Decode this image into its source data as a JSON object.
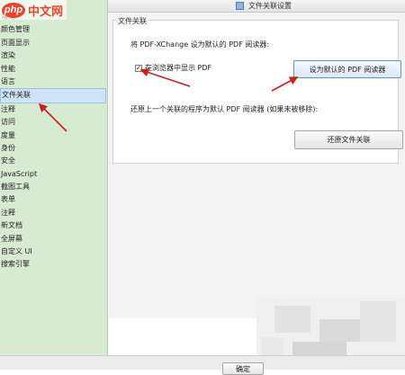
{
  "watermark": {
    "badge": "php",
    "text": "中文网"
  },
  "window": {
    "title": "文件关联设置"
  },
  "sidebar": {
    "items": [
      {
        "label": "常规"
      },
      {
        "label": "颜色管理"
      },
      {
        "label": "页面显示"
      },
      {
        "label": "渲染"
      },
      {
        "label": "性能"
      },
      {
        "label": "语言"
      },
      {
        "label": "文件关联",
        "active": true
      },
      {
        "label": "注释"
      },
      {
        "label": "访问"
      },
      {
        "label": "度量"
      },
      {
        "label": "身份"
      },
      {
        "label": "安全"
      },
      {
        "label": "JavaScript"
      },
      {
        "label": "截图工具"
      },
      {
        "label": "表单"
      },
      {
        "label": "注释"
      },
      {
        "label": "新文档"
      },
      {
        "label": "全屏幕"
      },
      {
        "label": "自定义 UI"
      },
      {
        "label": "搜索引擎"
      }
    ]
  },
  "panel": {
    "group_label": "文件关联",
    "set_text": "将 PDF-XChange 设为默认的 PDF 阅读器:",
    "checkbox_label": "在浏览器中显示 PDF",
    "checkbox_checked": true,
    "set_default_button": "设为默认的 PDF 阅读器",
    "restore_text": "还原上一个关联的程序为默认 PDF 阅读器 (如果未被移除):",
    "restore_button": "还原文件关联"
  },
  "footer": {
    "ok_button": "确定"
  },
  "colors": {
    "annotation_red": "#c8201c",
    "sidebar_bg": "#d7ead2",
    "accent_blue": "#5b95d3"
  }
}
